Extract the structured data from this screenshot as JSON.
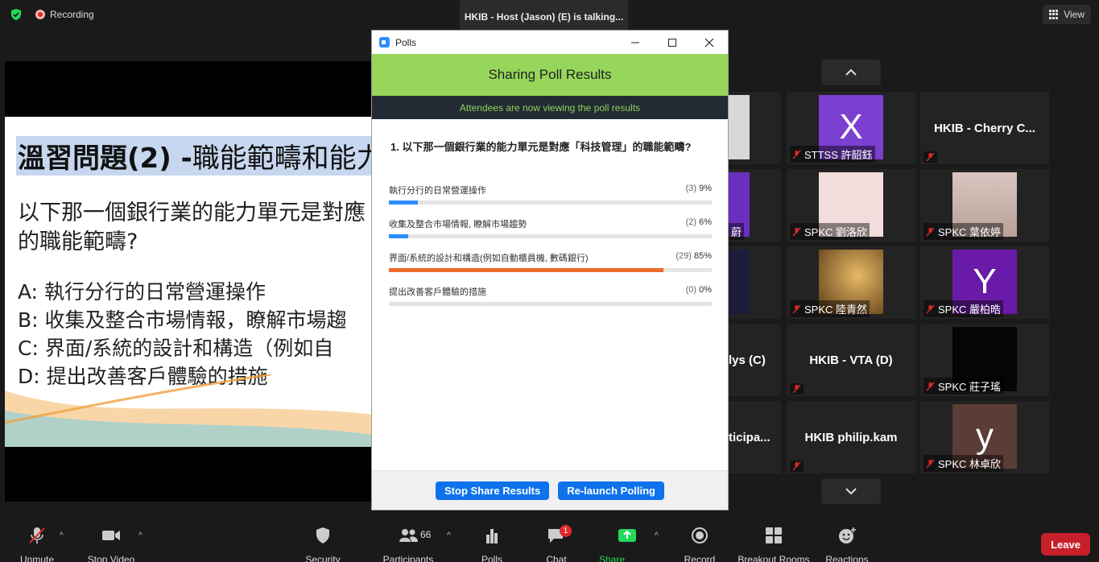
{
  "top_bar": {
    "recording_label": "Recording",
    "talking_text": "HKIB - Host (Jason) (E) is talking...",
    "view_label": "View"
  },
  "slide": {
    "title_bold": "溫習問題(2) -",
    "title_rest": "職能範疇和能力",
    "question_line1": "以下那一個銀行業的能力單元是對應",
    "question_line2": "的職能範疇?",
    "options": [
      "A: 執行分行的日常營運操作",
      "B: 收集及整合市場情報，瞭解市場趨",
      "C: 界面/系統的設計和構造（例如自",
      "D: 提出改善客戶體驗的措施"
    ]
  },
  "gallery": {
    "tiles": [
      {
        "name": "",
        "label": "",
        "type": "photo-partial"
      },
      {
        "name": "",
        "label": "STTSS 許韶鈺",
        "type": "letter",
        "letter": "X",
        "bg": "#7b3fd1"
      },
      {
        "name": "HKIB - Cherry C...",
        "label": "",
        "type": "name"
      },
      {
        "name": "",
        "label": "蔚",
        "type": "purple-partial"
      },
      {
        "name": "",
        "label": "SPKC 劉洛欣",
        "type": "photo-pink"
      },
      {
        "name": "",
        "label": "SPKC 葉依婷",
        "type": "photo-person"
      },
      {
        "name": "",
        "label": "",
        "type": "photo-dark"
      },
      {
        "name": "",
        "label": "SPKC 陸青然",
        "type": "photo-shadow"
      },
      {
        "name": "",
        "label": "SPKC 嚴柏晧",
        "type": "letter",
        "letter": "Y",
        "bg": "#6a1aa8"
      },
      {
        "name": "lys (C)",
        "label": "",
        "type": "name-partial"
      },
      {
        "name": "HKIB - VTA (D)",
        "label": "",
        "type": "name"
      },
      {
        "name": "",
        "label": "SPKC 莊子瑤",
        "type": "black"
      },
      {
        "name": "ticipa...",
        "label": "",
        "type": "name-partial"
      },
      {
        "name": "HKIB philip.kam",
        "label": "",
        "type": "name"
      },
      {
        "name": "",
        "label": "SPKC 林卓欣",
        "type": "letter",
        "letter": "y",
        "bg": "#5c3c36"
      }
    ]
  },
  "polls": {
    "window_title": "Polls",
    "header": "Sharing Poll Results",
    "status": "Attendees are now viewing the poll results",
    "question": "1. 以下那一個銀行業的能力單元是對應「科技管理」的職能範疇?",
    "options": [
      {
        "label": "執行分行的日常營運操作",
        "count": "(3)",
        "percent": "9%",
        "fraction": 0.09,
        "color": "#2d8cff"
      },
      {
        "label": "收集及整合市場情報, 瞭解市場趨勢",
        "count": "(2)",
        "percent": "6%",
        "fraction": 0.06,
        "color": "#2d8cff"
      },
      {
        "label": "界面/系統的設計和構造(例如自動櫃員機, 數碼銀行)",
        "count": "(29)",
        "percent": "85%",
        "fraction": 0.85,
        "color": "#ef6a2a"
      },
      {
        "label": "提出改善客戶體驗的措施",
        "count": "(0)",
        "percent": "0%",
        "fraction": 0.0,
        "color": "#2d8cff"
      }
    ],
    "stop_share_label": "Stop Share Results",
    "relaunch_label": "Re-launch Polling"
  },
  "toolbar": {
    "unmute": "Unmute",
    "stop_video": "Stop Video",
    "security": "Security",
    "participants": "Participants",
    "participants_count": "66",
    "polls": "Polls",
    "chat": "Chat",
    "chat_badge": "1",
    "share_screen": "Share Screen",
    "record": "Record",
    "breakout_rooms": "Breakout Rooms",
    "reactions": "Reactions",
    "leave": "Leave"
  }
}
